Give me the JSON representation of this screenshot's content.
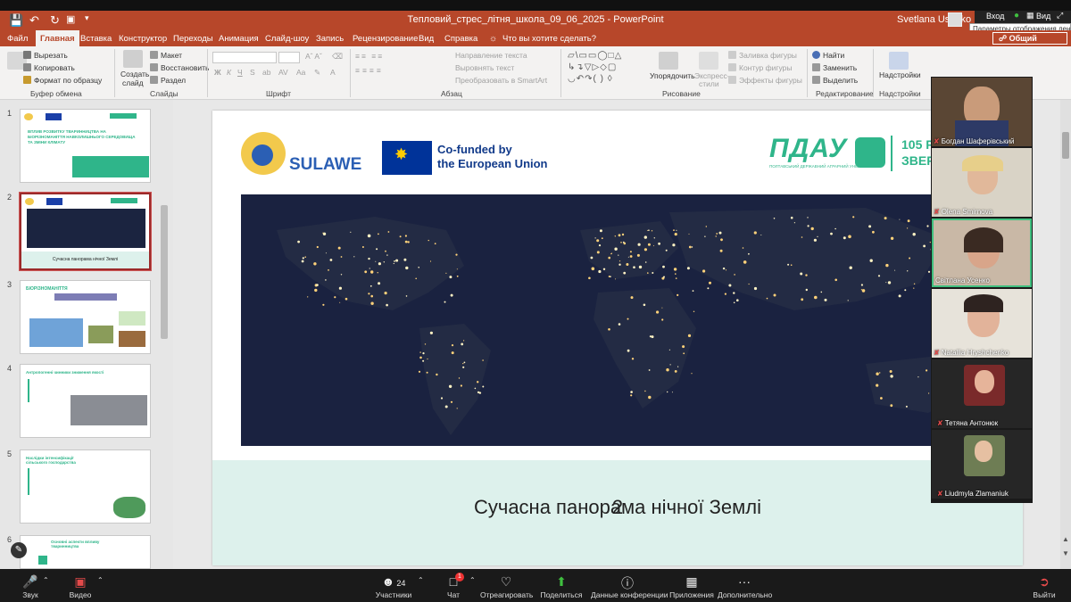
{
  "window": {
    "doc_title": "Тепловий_стрес_літня_школа_09_06_2025 - PowerPoint",
    "user_name": "Svetlana Usenko",
    "zoom_enter": "Вход",
    "zoom_view": "Вид",
    "tooltip": "Параметры отображения ленты"
  },
  "tabs": [
    "Файл",
    "Главная",
    "Вставка",
    "Конструктор",
    "Переходы",
    "Анимация",
    "Слайд-шоу",
    "Запись",
    "Рецензирование",
    "Вид",
    "Справка",
    "Что вы хотите сделать?"
  ],
  "share_button": "Общий доступ",
  "ribbon": {
    "clipboard": {
      "cut": "Вырезать",
      "copy": "Копировать",
      "format": "Формат по образцу",
      "label": "Буфер обмена"
    },
    "slides": {
      "create": "Создать",
      "create2": "слайд",
      "layout": "Макет",
      "reset": "Восстановить",
      "section": "Раздел",
      "label": "Слайды"
    },
    "font": {
      "label": "Шрифт"
    },
    "paragraph": {
      "direction": "Направление текста",
      "align": "Выровнять текст",
      "smartart": "Преобразовать в SmartArt",
      "label": "Абзац"
    },
    "drawing": {
      "arrange": "Упорядочить",
      "styles": "Экспресс-",
      "styles2": "стили",
      "fill": "Заливка фигуры",
      "outline": "Контур фигуры",
      "effects": "Эффекты фигуры",
      "label": "Рисование"
    },
    "editing": {
      "find": "Найти",
      "replace": "Заменить",
      "select": "Выделить",
      "label": "Редактирование"
    },
    "addins": {
      "settings": "Надстройки",
      "label": "Надстройки"
    }
  },
  "thumbnails": [
    {
      "num": "1",
      "title": "ВПЛИВ РОЗВИТКУ ТВАРИННИЦТВА НА БІОРІЗНОМАНІТТЯ НАВКОЛИШНЬОГО СЕРЕДОВИЩА ТА ЗМІНИ КЛІМАТУ"
    },
    {
      "num": "2",
      "caption": "Сучасна панорама нічної Землі"
    },
    {
      "num": "3",
      "title": "БІОРІЗНОМАНІТТЯ"
    },
    {
      "num": "4",
      "title": "Антропогенні чинники зниження якості"
    },
    {
      "num": "5",
      "title": "Наслідки інтенсифікації сільського господарства"
    },
    {
      "num": "6",
      "title": "Основні аспекти впливу тваринництва"
    }
  ],
  "slide": {
    "sulawe": "SULAWE",
    "eu_line1": "Co-funded by",
    "eu_line2": "the European Union",
    "pdau": "ПДАУ",
    "pdau_sub": "ПОЛТАВСЬКИЙ ДЕРЖАВНИЙ АГРАРНИЙ УНІВЕРСИТЕТ",
    "anniv": "105 Р",
    "anniv2": "ЗВЕР",
    "title": "Сучасна панорама нічної Землі",
    "number": "2"
  },
  "participants": [
    {
      "name": "Богдан Шаферівський",
      "muted": true,
      "active": false
    },
    {
      "name": "Olena Smirnova",
      "muted": true,
      "active": false
    },
    {
      "name": "Світлана Усенко",
      "muted": false,
      "active": true
    },
    {
      "name": "Natallia Hryshchenko",
      "muted": true,
      "active": false
    },
    {
      "name": "Тетяна Антонюк",
      "muted": true,
      "active": false
    },
    {
      "name": "Liudmyla Zlamaniuk",
      "muted": true,
      "active": false
    }
  ],
  "zoom_toolbar": {
    "audio": "Звук",
    "video": "Видео",
    "participants": "Участники",
    "participants_count": "24",
    "chat": "Чат",
    "chat_badge": "1",
    "react": "Отреагировать",
    "share": "Поделиться",
    "info": "Данные конференции",
    "apps": "Приложения",
    "more": "Дополнительно",
    "leave": "Выйти"
  },
  "colors": {
    "ppt_accent": "#b7472a",
    "slide_band": "#ddf1ec",
    "pdau_green": "#2fb58a",
    "eu_blue": "#003399",
    "active_tile": "#3fbf7f"
  }
}
